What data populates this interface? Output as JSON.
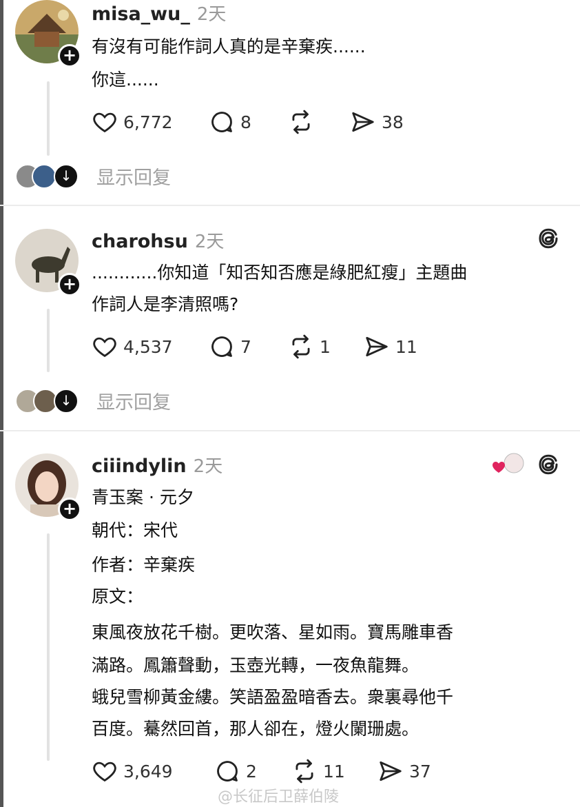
{
  "posts": [
    {
      "username": "misa_wu_",
      "time": "2天",
      "lines": [
        "有沒有可能作詞人真的是辛棄疾......",
        "你這......"
      ],
      "likes": "6,772",
      "comments": "8",
      "reposts": "",
      "shares": "38",
      "show_replies": "显示回复"
    },
    {
      "username": "charohsu",
      "time": "2天",
      "lines": [
        "............你知道「知否知否應是綠肥紅瘦」主題曲",
        "作詞人是李清照嗎?"
      ],
      "likes": "4,537",
      "comments": "7",
      "reposts": "1",
      "shares": "11",
      "show_replies": "显示回复"
    },
    {
      "username": "ciiindylin",
      "time": "2天",
      "lines": [
        "青玉案 · 元夕",
        "朝代：宋代",
        "作者：辛棄疾",
        "原文：",
        "東風夜放花千樹。更吹落、星如雨。寶馬雕車香",
        "滿路。鳳簫聲動，玉壺光轉，一夜魚龍舞。",
        "蛾兒雪柳黃金縷。笑語盈盈暗香去。衆裏尋他千",
        "百度。驀然回首，那人卻在，燈火闌珊處。"
      ],
      "likes": "3,649",
      "comments": "2",
      "reposts": "11",
      "shares": "37"
    }
  ],
  "watermark": "@长征后卫薛伯陵",
  "icons": {
    "like": "heart-icon",
    "comment": "comment-bubble-icon",
    "repost": "repost-icon",
    "share": "send-icon",
    "threads": "threads-logo-icon",
    "follow": "plus-icon"
  },
  "colors": {
    "muted": "#9a9a9a",
    "text": "#111111",
    "divider": "#ececec",
    "heart": "#e0245e"
  }
}
